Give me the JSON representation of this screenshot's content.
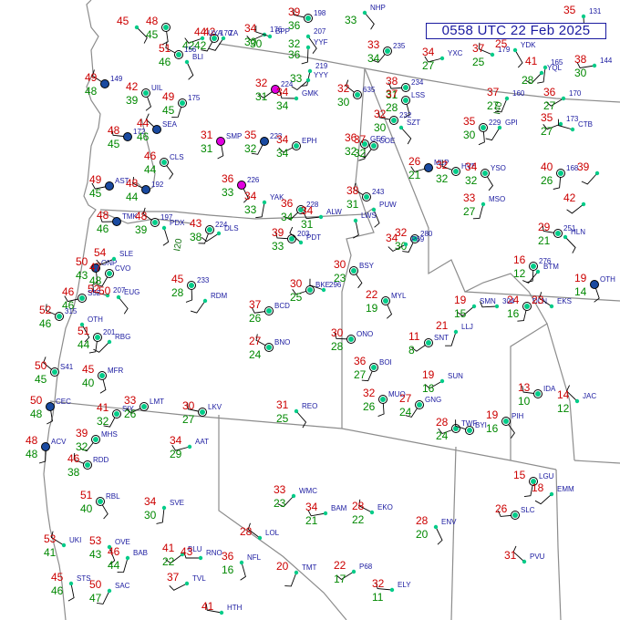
{
  "header": {
    "title": "0558 UTC 22 Feb 2025"
  },
  "colors": {
    "temperature": "#cc0000",
    "dewpoint": "#008800",
    "station_id": "#1a1aa0",
    "border": "#8c8c8c",
    "wind_barb": "#000000",
    "cloud_clear": "#ffffff",
    "cloud_overcast": "#1a4aa0",
    "cloud_magenta": "#e000e0",
    "station_ring": "#00cc88"
  },
  "icons": {
    "station_model": "circle-cloud-cover-icon",
    "wind_barb": "wind-barb-icon"
  },
  "stations": [
    {
      "id": "",
      "t": "45",
      "td": "",
      "cover": "none"
    },
    {
      "id": "",
      "t": "48",
      "td": "45",
      "cover": "clear"
    },
    {
      "id": "170",
      "t": "44",
      "td": "42",
      "cover": "clear"
    },
    {
      "id": "176",
      "t": "34",
      "td": "30",
      "cover": "none"
    },
    {
      "id": "198",
      "t": "39",
      "td": "36",
      "cover": "clear"
    },
    {
      "id": "NHP",
      "t": "",
      "td": "33",
      "cover": "none"
    },
    {
      "id": "131",
      "t": "35",
      "td": "",
      "cover": "none"
    },
    {
      "id": "ZA",
      "t": "42",
      "td": "",
      "cover": "none"
    },
    {
      "id": "UYA",
      "t": "",
      "td": "42",
      "cover": "none"
    },
    {
      "id": "BPP",
      "t": "",
      "td": "30",
      "cover": "none"
    },
    {
      "id": "207",
      "t": "",
      "td": "32",
      "cover": "none"
    },
    {
      "id": "YYF",
      "t": "",
      "td": "36",
      "cover": "none"
    },
    {
      "id": "235",
      "t": "33",
      "td": "34",
      "cover": "clear"
    },
    {
      "id": "YXC",
      "t": "34",
      "td": "27",
      "cover": "none"
    },
    {
      "id": "179",
      "t": "37",
      "td": "25",
      "cover": "none"
    },
    {
      "id": "YDK",
      "t": "25",
      "td": "",
      "cover": "none"
    },
    {
      "id": "165",
      "t": "41",
      "td": "",
      "cover": "none"
    },
    {
      "id": "YQL",
      "t": "",
      "td": "28",
      "cover": "none"
    },
    {
      "id": "144",
      "t": "38",
      "td": "30",
      "cover": "none"
    },
    {
      "id": "156",
      "t": "51",
      "td": "46",
      "cover": "clear"
    },
    {
      "id": "BLI",
      "t": "",
      "td": "",
      "cover": "none"
    },
    {
      "id": "219",
      "t": "",
      "td": "33",
      "cover": "none"
    },
    {
      "id": "YYY",
      "t": "",
      "td": "",
      "cover": "none"
    },
    {
      "id": "234",
      "t": "38",
      "td": "31",
      "cover": "clear"
    },
    {
      "id": "149",
      "t": "49",
      "td": "48",
      "cover": "overcast"
    },
    {
      "id": "UIL",
      "t": "42",
      "td": "39",
      "cover": "clear"
    },
    {
      "id": "175",
      "t": "49",
      "td": "45",
      "cover": "clear"
    },
    {
      "id": "224",
      "t": "32",
      "td": "31",
      "cover": "magenta"
    },
    {
      "id": "GMK",
      "t": "34",
      "td": "34",
      "cover": "none"
    },
    {
      "id": "635",
      "t": "32",
      "td": "30",
      "cover": "clear"
    },
    {
      "id": "LSS",
      "t": "37",
      "td": "28",
      "cover": "clear"
    },
    {
      "id": "160",
      "t": "37",
      "td": "27",
      "cover": "none"
    },
    {
      "id": "170",
      "t": "36",
      "td": "27",
      "cover": "none"
    },
    {
      "id": "172",
      "t": "48",
      "td": "45",
      "cover": "overcast"
    },
    {
      "id": "SEA",
      "t": "44",
      "td": "46",
      "cover": "overcast"
    },
    {
      "id": "SMP",
      "t": "31",
      "td": "31",
      "cover": "magenta"
    },
    {
      "id": "223",
      "t": "35",
      "td": "32",
      "cover": "overcast"
    },
    {
      "id": "EPH",
      "t": "34",
      "td": "34",
      "cover": "clear"
    },
    {
      "id": "232",
      "t": "32",
      "td": "30",
      "cover": "clear"
    },
    {
      "id": "SZT",
      "t": "",
      "td": "",
      "cover": "none"
    },
    {
      "id": "229",
      "t": "35",
      "td": "30",
      "cover": "clear"
    },
    {
      "id": "GPI",
      "t": "",
      "td": "",
      "cover": "none"
    },
    {
      "id": "173",
      "t": "35",
      "td": "27",
      "cover": "none"
    },
    {
      "id": "CTB",
      "t": "",
      "td": "",
      "cover": "none"
    },
    {
      "id": "CLS",
      "t": "46",
      "td": "44",
      "cover": "clear"
    },
    {
      "id": "GEG",
      "t": "36",
      "td": "32",
      "cover": "clear"
    },
    {
      "id": "COE",
      "t": "37",
      "td": "32",
      "cover": "clear"
    },
    {
      "id": "MLP",
      "t": "26",
      "td": "21",
      "cover": "overcast"
    },
    {
      "id": "HVE",
      "t": "32",
      "td": "32",
      "cover": "clear"
    },
    {
      "id": "YSO",
      "t": "34",
      "td": "32",
      "cover": "clear"
    },
    {
      "id": "168",
      "t": "40",
      "td": "26",
      "cover": "clear"
    },
    {
      "id": "",
      "t": "39",
      "td": "",
      "cover": "none"
    },
    {
      "id": "AST",
      "t": "49",
      "td": "45",
      "cover": "overcast"
    },
    {
      "id": "192",
      "t": "48",
      "td": "44",
      "cover": "overcast"
    },
    {
      "id": "226",
      "t": "36",
      "td": "33",
      "cover": "magenta"
    },
    {
      "id": "YAK",
      "t": "34",
      "td": "33",
      "cover": "none"
    },
    {
      "id": "228",
      "t": "36",
      "td": "34",
      "cover": "clear"
    },
    {
      "id": "ALW",
      "t": "34",
      "td": "31",
      "cover": "none"
    },
    {
      "id": "243",
      "t": "38",
      "td": "31",
      "cover": "clear"
    },
    {
      "id": "PUW",
      "t": "",
      "td": "",
      "cover": "none"
    },
    {
      "id": "MSO",
      "t": "33",
      "td": "27",
      "cover": "none"
    },
    {
      "id": "",
      "t": "42",
      "td": "",
      "cover": "none"
    },
    {
      "id": "TMK",
      "t": "48",
      "td": "46",
      "cover": "overcast"
    },
    {
      "id": "197",
      "t": "48",
      "td": "39",
      "cover": "clear"
    },
    {
      "id": "PDX",
      "t": "",
      "td": "",
      "cover": "none"
    },
    {
      "id": "224",
      "t": "43",
      "td": "38",
      "cover": "clear"
    },
    {
      "id": "DLS",
      "t": "",
      "td": "",
      "cover": "none"
    },
    {
      "id": "203",
      "t": "39",
      "td": "33",
      "cover": "clear"
    },
    {
      "id": "PDT",
      "t": "",
      "td": "",
      "cover": "none"
    },
    {
      "id": "LWS",
      "t": "",
      "td": "",
      "cover": "none"
    },
    {
      "id": "280",
      "t": "32",
      "td": "30",
      "cover": "clear"
    },
    {
      "id": "P69",
      "t": "34",
      "td": "",
      "cover": "none"
    },
    {
      "id": "251",
      "t": "29",
      "td": "21",
      "cover": "clear"
    },
    {
      "id": "HLN",
      "t": "",
      "td": "",
      "cover": "none"
    },
    {
      "id": "ONP",
      "t": "50",
      "td": "43",
      "cover": "overcast"
    },
    {
      "id": "CVO",
      "t": "47",
      "td": "48",
      "cover": "clear"
    },
    {
      "id": "SLE",
      "t": "54",
      "td": "",
      "cover": "none"
    },
    {
      "id": "207",
      "t": "52",
      "td": "",
      "cover": "none"
    },
    {
      "id": "EUG",
      "t": "50",
      "td": "",
      "cover": "none"
    },
    {
      "id": "233",
      "t": "45",
      "td": "28",
      "cover": "clear"
    },
    {
      "id": "RDM",
      "t": "",
      "td": "",
      "cover": "none"
    },
    {
      "id": "BKE",
      "t": "30",
      "td": "25",
      "cover": "clear"
    },
    {
      "id": "296",
      "t": "",
      "td": "",
      "cover": "none"
    },
    {
      "id": "BSY",
      "t": "30",
      "td": "23",
      "cover": "clear"
    },
    {
      "id": "276",
      "t": "16",
      "td": "12",
      "cover": "clear"
    },
    {
      "id": "BTM",
      "t": "",
      "td": "",
      "cover": "none"
    },
    {
      "id": "S52",
      "t": "46",
      "td": "46",
      "cover": "clear"
    },
    {
      "id": "315",
      "t": "52",
      "td": "46",
      "cover": "clear"
    },
    {
      "id": "OTH",
      "t": "",
      "td": "",
      "cover": "none"
    },
    {
      "id": "201",
      "t": "51",
      "td": "44",
      "cover": "clear"
    },
    {
      "id": "RBG",
      "t": "",
      "td": "",
      "cover": "none"
    },
    {
      "id": "BCD",
      "t": "37",
      "td": "26",
      "cover": "clear"
    },
    {
      "id": "BNO",
      "t": "27",
      "td": "24",
      "cover": "clear"
    },
    {
      "id": "MYL",
      "t": "22",
      "td": "19",
      "cover": "clear"
    },
    {
      "id": "DLN",
      "t": "24",
      "td": "16",
      "cover": "clear"
    },
    {
      "id": "SMN",
      "t": "19",
      "td": "15",
      "cover": "none"
    },
    {
      "id": "304",
      "t": "",
      "td": "",
      "cover": "none"
    },
    {
      "id": "EKS",
      "t": "23",
      "td": "",
      "cover": "none"
    },
    {
      "id": "OTH",
      "t": "19",
      "td": "14",
      "cover": "overcast"
    },
    {
      "id": "LLJ",
      "t": "21",
      "td": "",
      "cover": "none"
    },
    {
      "id": "SNT",
      "t": "11",
      "td": "8",
      "cover": "clear"
    },
    {
      "id": "ONO",
      "t": "30",
      "td": "28",
      "cover": "clear"
    },
    {
      "id": "S41",
      "t": "50",
      "td": "45",
      "cover": "clear"
    },
    {
      "id": "MFR",
      "t": "45",
      "td": "40",
      "cover": "clear"
    },
    {
      "id": "BOI",
      "t": "36",
      "td": "27",
      "cover": "clear"
    },
    {
      "id": "SUN",
      "t": "19",
      "td": "16",
      "cover": "none"
    },
    {
      "id": "IDA",
      "t": "13",
      "td": "10",
      "cover": "clear"
    },
    {
      "id": "JAC",
      "t": "14",
      "td": "12",
      "cover": "none"
    },
    {
      "id": "CEC",
      "t": "50",
      "td": "48",
      "cover": "overcast"
    },
    {
      "id": "SIY",
      "t": "41",
      "td": "32",
      "cover": "clear"
    },
    {
      "id": "LMT",
      "t": "33",
      "td": "26",
      "cover": "clear"
    },
    {
      "id": "LKV",
      "t": "30",
      "td": "27",
      "cover": "clear"
    },
    {
      "id": "REO",
      "t": "31",
      "td": "25",
      "cover": "none"
    },
    {
      "id": "MUO",
      "t": "32",
      "td": "26",
      "cover": "clear"
    },
    {
      "id": "GNG",
      "t": "27",
      "td": "24",
      "cover": "clear"
    },
    {
      "id": "TWF",
      "t": "28",
      "td": "24",
      "cover": "clear"
    },
    {
      "id": "BYI",
      "t": "",
      "td": "",
      "cover": "clear"
    },
    {
      "id": "PIH",
      "t": "19",
      "td": "16",
      "cover": "clear"
    },
    {
      "id": "ACV",
      "t": "48",
      "td": "48",
      "cover": "overcast"
    },
    {
      "id": "MHS",
      "t": "39",
      "td": "32",
      "cover": "clear"
    },
    {
      "id": "AAT",
      "t": "34",
      "td": "29",
      "cover": "none"
    },
    {
      "id": "RDD",
      "t": "46",
      "td": "38",
      "cover": "clear"
    },
    {
      "id": "RBL",
      "t": "51",
      "td": "40",
      "cover": "clear"
    },
    {
      "id": "SVE",
      "t": "34",
      "td": "30",
      "cover": "none"
    },
    {
      "id": "WMC",
      "t": "33",
      "td": "23",
      "cover": "none"
    },
    {
      "id": "BAM",
      "t": "34",
      "td": "21",
      "cover": "none"
    },
    {
      "id": "EKO",
      "t": "28",
      "td": "22",
      "cover": "none"
    },
    {
      "id": "ENV",
      "t": "28",
      "td": "20",
      "cover": "none"
    },
    {
      "id": "LGU",
      "t": "15",
      "td": "",
      "cover": "clear"
    },
    {
      "id": "EMM",
      "t": "18",
      "td": "",
      "cover": "none"
    },
    {
      "id": "SLC",
      "t": "26",
      "td": "",
      "cover": "clear"
    },
    {
      "id": "UKI",
      "t": "53",
      "td": "41",
      "cover": "none"
    },
    {
      "id": "OVE",
      "t": "53",
      "td": "43",
      "cover": "none"
    },
    {
      "id": "BAB",
      "t": "46",
      "td": "44",
      "cover": "none"
    },
    {
      "id": "BLU",
      "t": "41",
      "td": "22",
      "cover": "none"
    },
    {
      "id": "RNO",
      "t": "43",
      "td": "",
      "cover": "none"
    },
    {
      "id": "LOL",
      "t": "28",
      "td": "",
      "cover": "none"
    },
    {
      "id": "NFL",
      "t": "36",
      "td": "16",
      "cover": "none"
    },
    {
      "id": "TMT",
      "t": "20",
      "td": "",
      "cover": "none"
    },
    {
      "id": "P68",
      "t": "22",
      "td": "17",
      "cover": "none"
    },
    {
      "id": "ELY",
      "t": "32",
      "td": "11",
      "cover": "none"
    },
    {
      "id": "PVU",
      "t": "31",
      "td": "",
      "cover": "none"
    },
    {
      "id": "STS",
      "t": "45",
      "td": "46",
      "cover": "none"
    },
    {
      "id": "SAC",
      "t": "50",
      "td": "47",
      "cover": "none"
    },
    {
      "id": "TVL",
      "t": "37",
      "td": "",
      "cover": "none"
    },
    {
      "id": "HTH",
      "t": "41",
      "td": "",
      "cover": "none"
    }
  ]
}
